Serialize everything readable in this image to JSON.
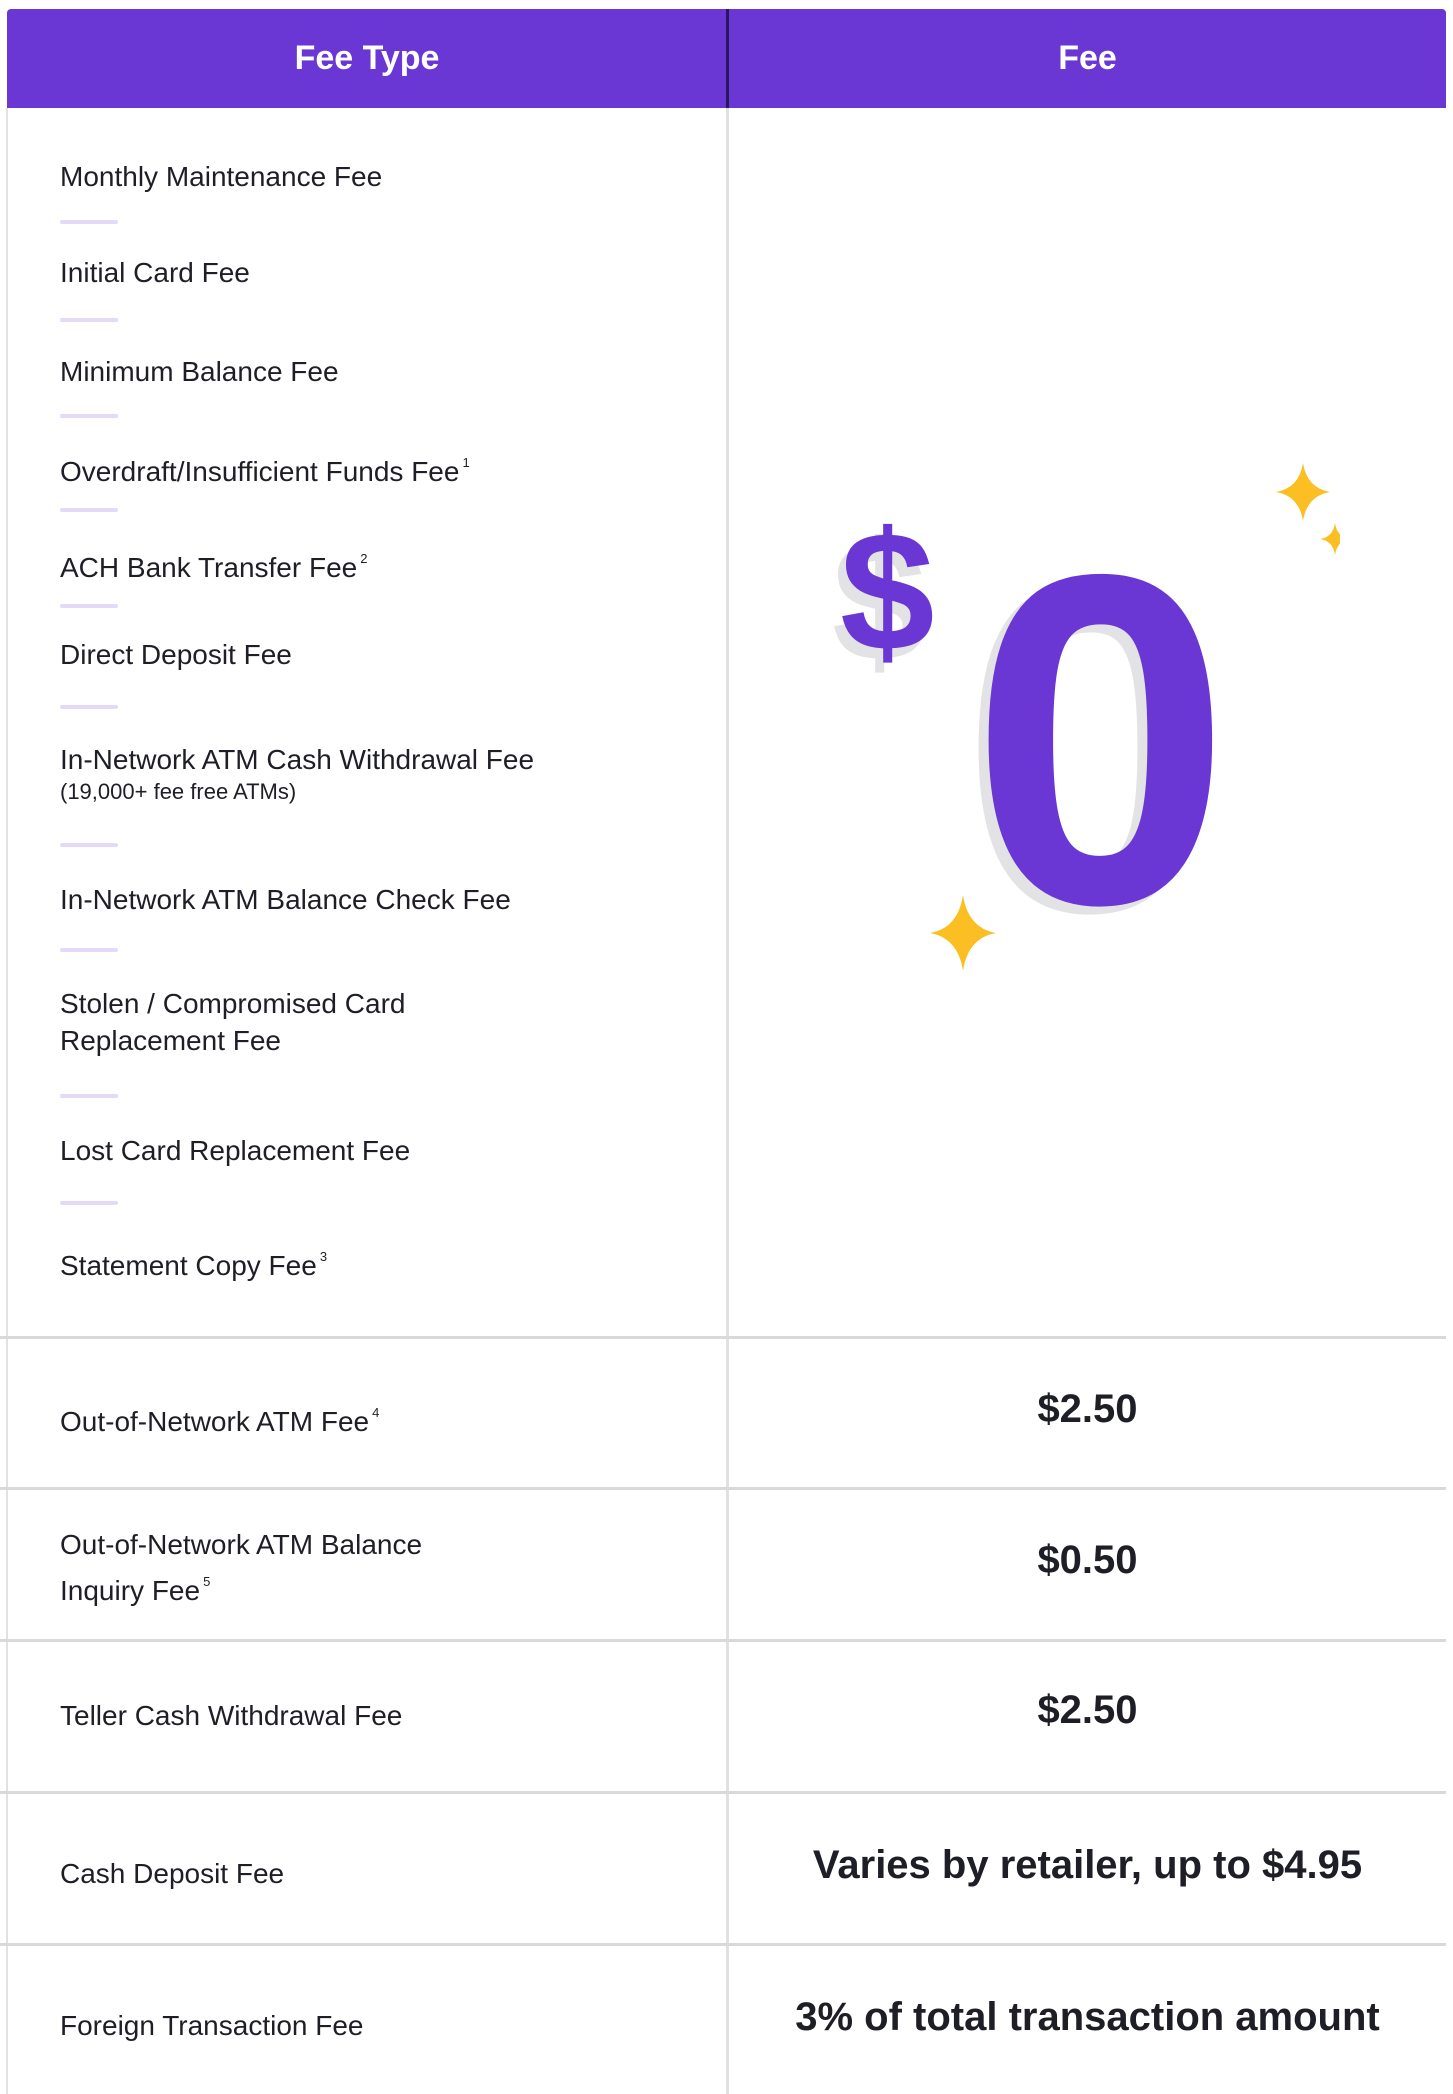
{
  "header": {
    "fee_type": "Fee Type",
    "fee": "Fee"
  },
  "zero_fee_group": {
    "amount": "$0",
    "items": [
      {
        "label": "Monthly Maintenance Fee"
      },
      {
        "label": "Initial Card Fee"
      },
      {
        "label": "Minimum Balance Fee"
      },
      {
        "label": "Overdraft/Insufficient Funds Fee",
        "footnote": "1"
      },
      {
        "label": "ACH Bank Transfer Fee",
        "footnote": "2"
      },
      {
        "label": "Direct Deposit Fee"
      },
      {
        "label": "In-Network ATM Cash Withdrawal Fee",
        "sub": "(19,000+ fee free ATMs)"
      },
      {
        "label": "In-Network ATM Balance Check Fee"
      },
      {
        "label": "Stolen / Compromised Card",
        "label2": "Replacement Fee"
      },
      {
        "label": "Lost Card Replacement Fee"
      },
      {
        "label": "Statement Copy Fee",
        "footnote": "3"
      }
    ]
  },
  "rows": [
    {
      "label": "Out-of-Network ATM Fee",
      "footnote": "4",
      "fee": "$2.50"
    },
    {
      "label": "Out-of-Network ATM Balance",
      "label2": "Inquiry Fee",
      "footnote": "5",
      "fee": "$0.50"
    },
    {
      "label": "Teller Cash Withdrawal Fee",
      "fee": "$2.50"
    },
    {
      "label": "Cash Deposit Fee",
      "fee": "Varies by retailer, up to $4.95"
    },
    {
      "label": "Foreign Transaction Fee",
      "fee": "3% of total transaction amount"
    }
  ],
  "colors": {
    "header_bg": "#6a37d4",
    "zero_purple": "#6a37d4",
    "sparkle": "#fbbf24",
    "divider": "#e4d9f6"
  }
}
